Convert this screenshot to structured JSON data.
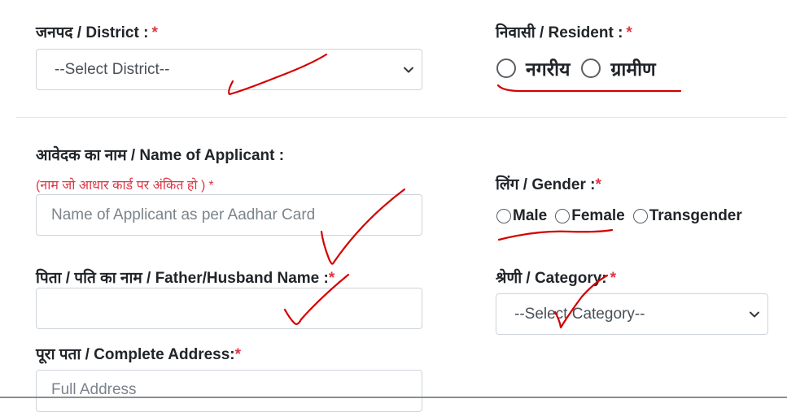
{
  "district": {
    "label": "जनपद / District :",
    "required": "*",
    "select_value": "--Select District--"
  },
  "resident": {
    "label": "निवासी / Resident :",
    "required": "*",
    "options": [
      "नगरीय",
      "ग्रामीण"
    ]
  },
  "applicant": {
    "label": "आवेदक का नाम / Name of Applicant :",
    "note": "(नाम जो आधार कार्ड पर अंकित हो )",
    "required": "*",
    "placeholder": "Name of Applicant as per Aadhar Card",
    "value": ""
  },
  "gender": {
    "label": "लिंग / Gender :",
    "required": "*",
    "options": [
      "Male",
      "Female",
      "Transgender"
    ]
  },
  "father": {
    "label": "पिता / पति का नाम / Father/Husband Name :",
    "required": "*",
    "value": ""
  },
  "category": {
    "label": "श्रेणी / Category:",
    "required": "*",
    "select_value": "--Select Category--"
  },
  "address": {
    "label": "पूरा पता / Complete Address:",
    "required": "*",
    "placeholder": "Full Address"
  },
  "annotation_color": "#d40000"
}
